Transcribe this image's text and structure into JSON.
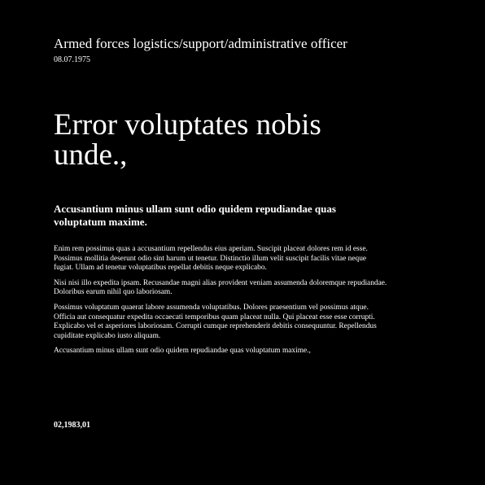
{
  "header": {
    "job_title": "Armed forces logistics/support/administrative officer",
    "date": "08.07.1975"
  },
  "main": {
    "title": "Error voluptates nobis unde.,",
    "subtitle": "Accusantium minus ullam sunt odio quidem repudiandae quas voluptatum maxime.",
    "paragraphs": [
      "Enim rem possimus quas a accusantium repellendus eius aperiam. Suscipit placeat dolores rem id esse. Possimus mollitia deserunt odio sint harum ut tenetur. Distinctio illum velit suscipit facilis vitae neque fugiat. Ullam ad tenetur voluptatibus repellat debitis neque explicabo.",
      "Nisi nisi illo expedita ipsam. Recusandae magni alias provident veniam assumenda doloremque repudiandae. Doloribus earum nihil quo laboriosam.",
      "Possimus voluptatum quaerat labore assumenda voluptatibus. Dolores praesentium vel possimus atque. Officia aut consequatur expedita occaecati temporibus quam placeat nulla. Qui placeat esse esse corrupti. Explicabo vel et asperiores laboriosam. Corrupti cumque reprehenderit debitis consequuntur. Repellendus cupiditate explicabo iusto aliquam.",
      "Accusantium minus ullam sunt odio quidem repudiandae quas voluptatum maxime.,"
    ]
  },
  "footer": {
    "text": "02,1983,01"
  }
}
